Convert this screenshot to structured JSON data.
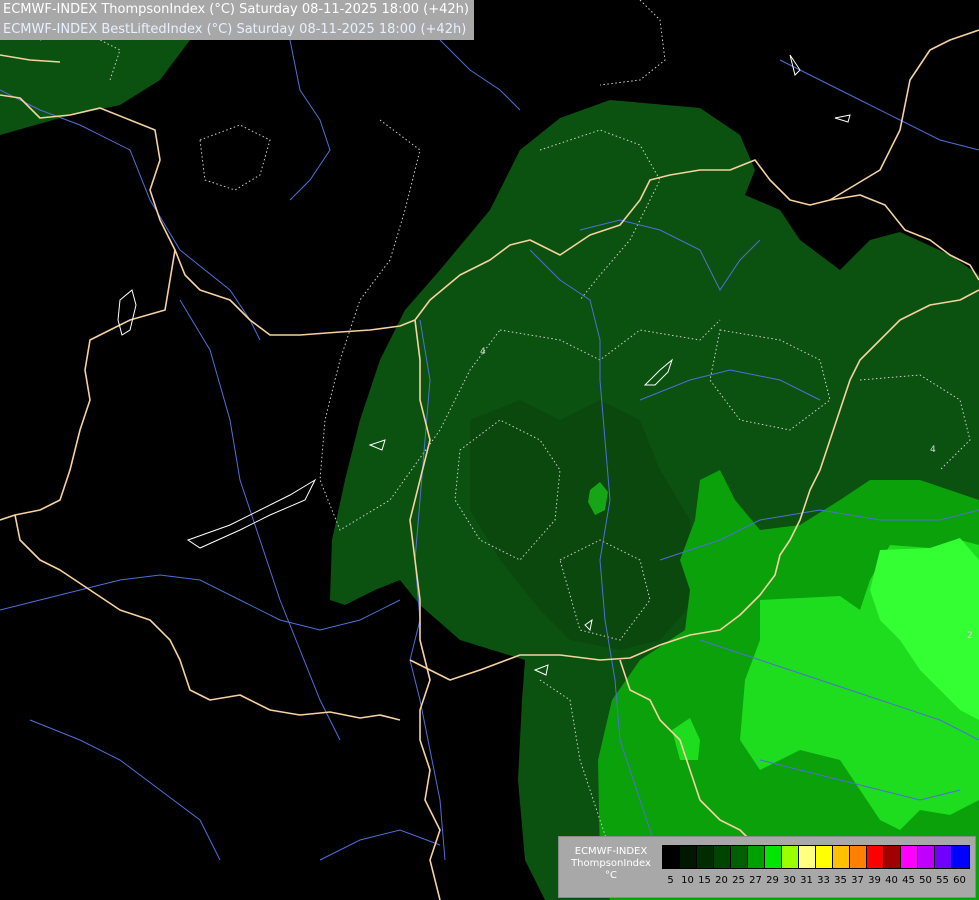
{
  "header": {
    "title_line1": "ECMWF-INDEX ThompsonIndex (°C) Saturday 08-11-2025 18:00 (+42h)",
    "title_line2": "ECMWF-INDEX BestLiftedIndex (°C) Saturday 08-11-2025 18:00 (+42h)"
  },
  "legend": {
    "model": "ECMWF-INDEX",
    "parameter": "ThompsonIndex",
    "unit": "°C",
    "bins": [
      {
        "tick": "5",
        "color": "#000000"
      },
      {
        "tick": "10",
        "color": "#001800"
      },
      {
        "tick": "15",
        "color": "#002c00"
      },
      {
        "tick": "20",
        "color": "#004400"
      },
      {
        "tick": "25",
        "color": "#005f00"
      },
      {
        "tick": "27",
        "color": "#00a000"
      },
      {
        "tick": "29",
        "color": "#00e600"
      },
      {
        "tick": "30",
        "color": "#9aff00"
      },
      {
        "tick": "31",
        "color": "#ffff80"
      },
      {
        "tick": "33",
        "color": "#ffff00"
      },
      {
        "tick": "35",
        "color": "#ffc000"
      },
      {
        "tick": "37",
        "color": "#ff8000"
      },
      {
        "tick": "39",
        "color": "#ff0000"
      },
      {
        "tick": "40",
        "color": "#a00000"
      },
      {
        "tick": "45",
        "color": "#ff00ff"
      },
      {
        "tick": "50",
        "color": "#c000ff"
      },
      {
        "tick": "55",
        "color": "#7000ff"
      },
      {
        "tick": "60",
        "color": "#0000ff"
      }
    ]
  },
  "map": {
    "contour_labels": [
      "4",
      "4",
      "2"
    ],
    "colors": {
      "background": "#000000",
      "dark_green": "#0b5210",
      "darker_green": "#0a4a0e",
      "mid_green": "#0aa10a",
      "bright_green": "#20e020",
      "lime": "#33ff33",
      "borders": "#f5d2a0",
      "rivers": "#4f6fd8",
      "lakes": "#ffffff",
      "isolines": "#cfcfcf"
    }
  }
}
